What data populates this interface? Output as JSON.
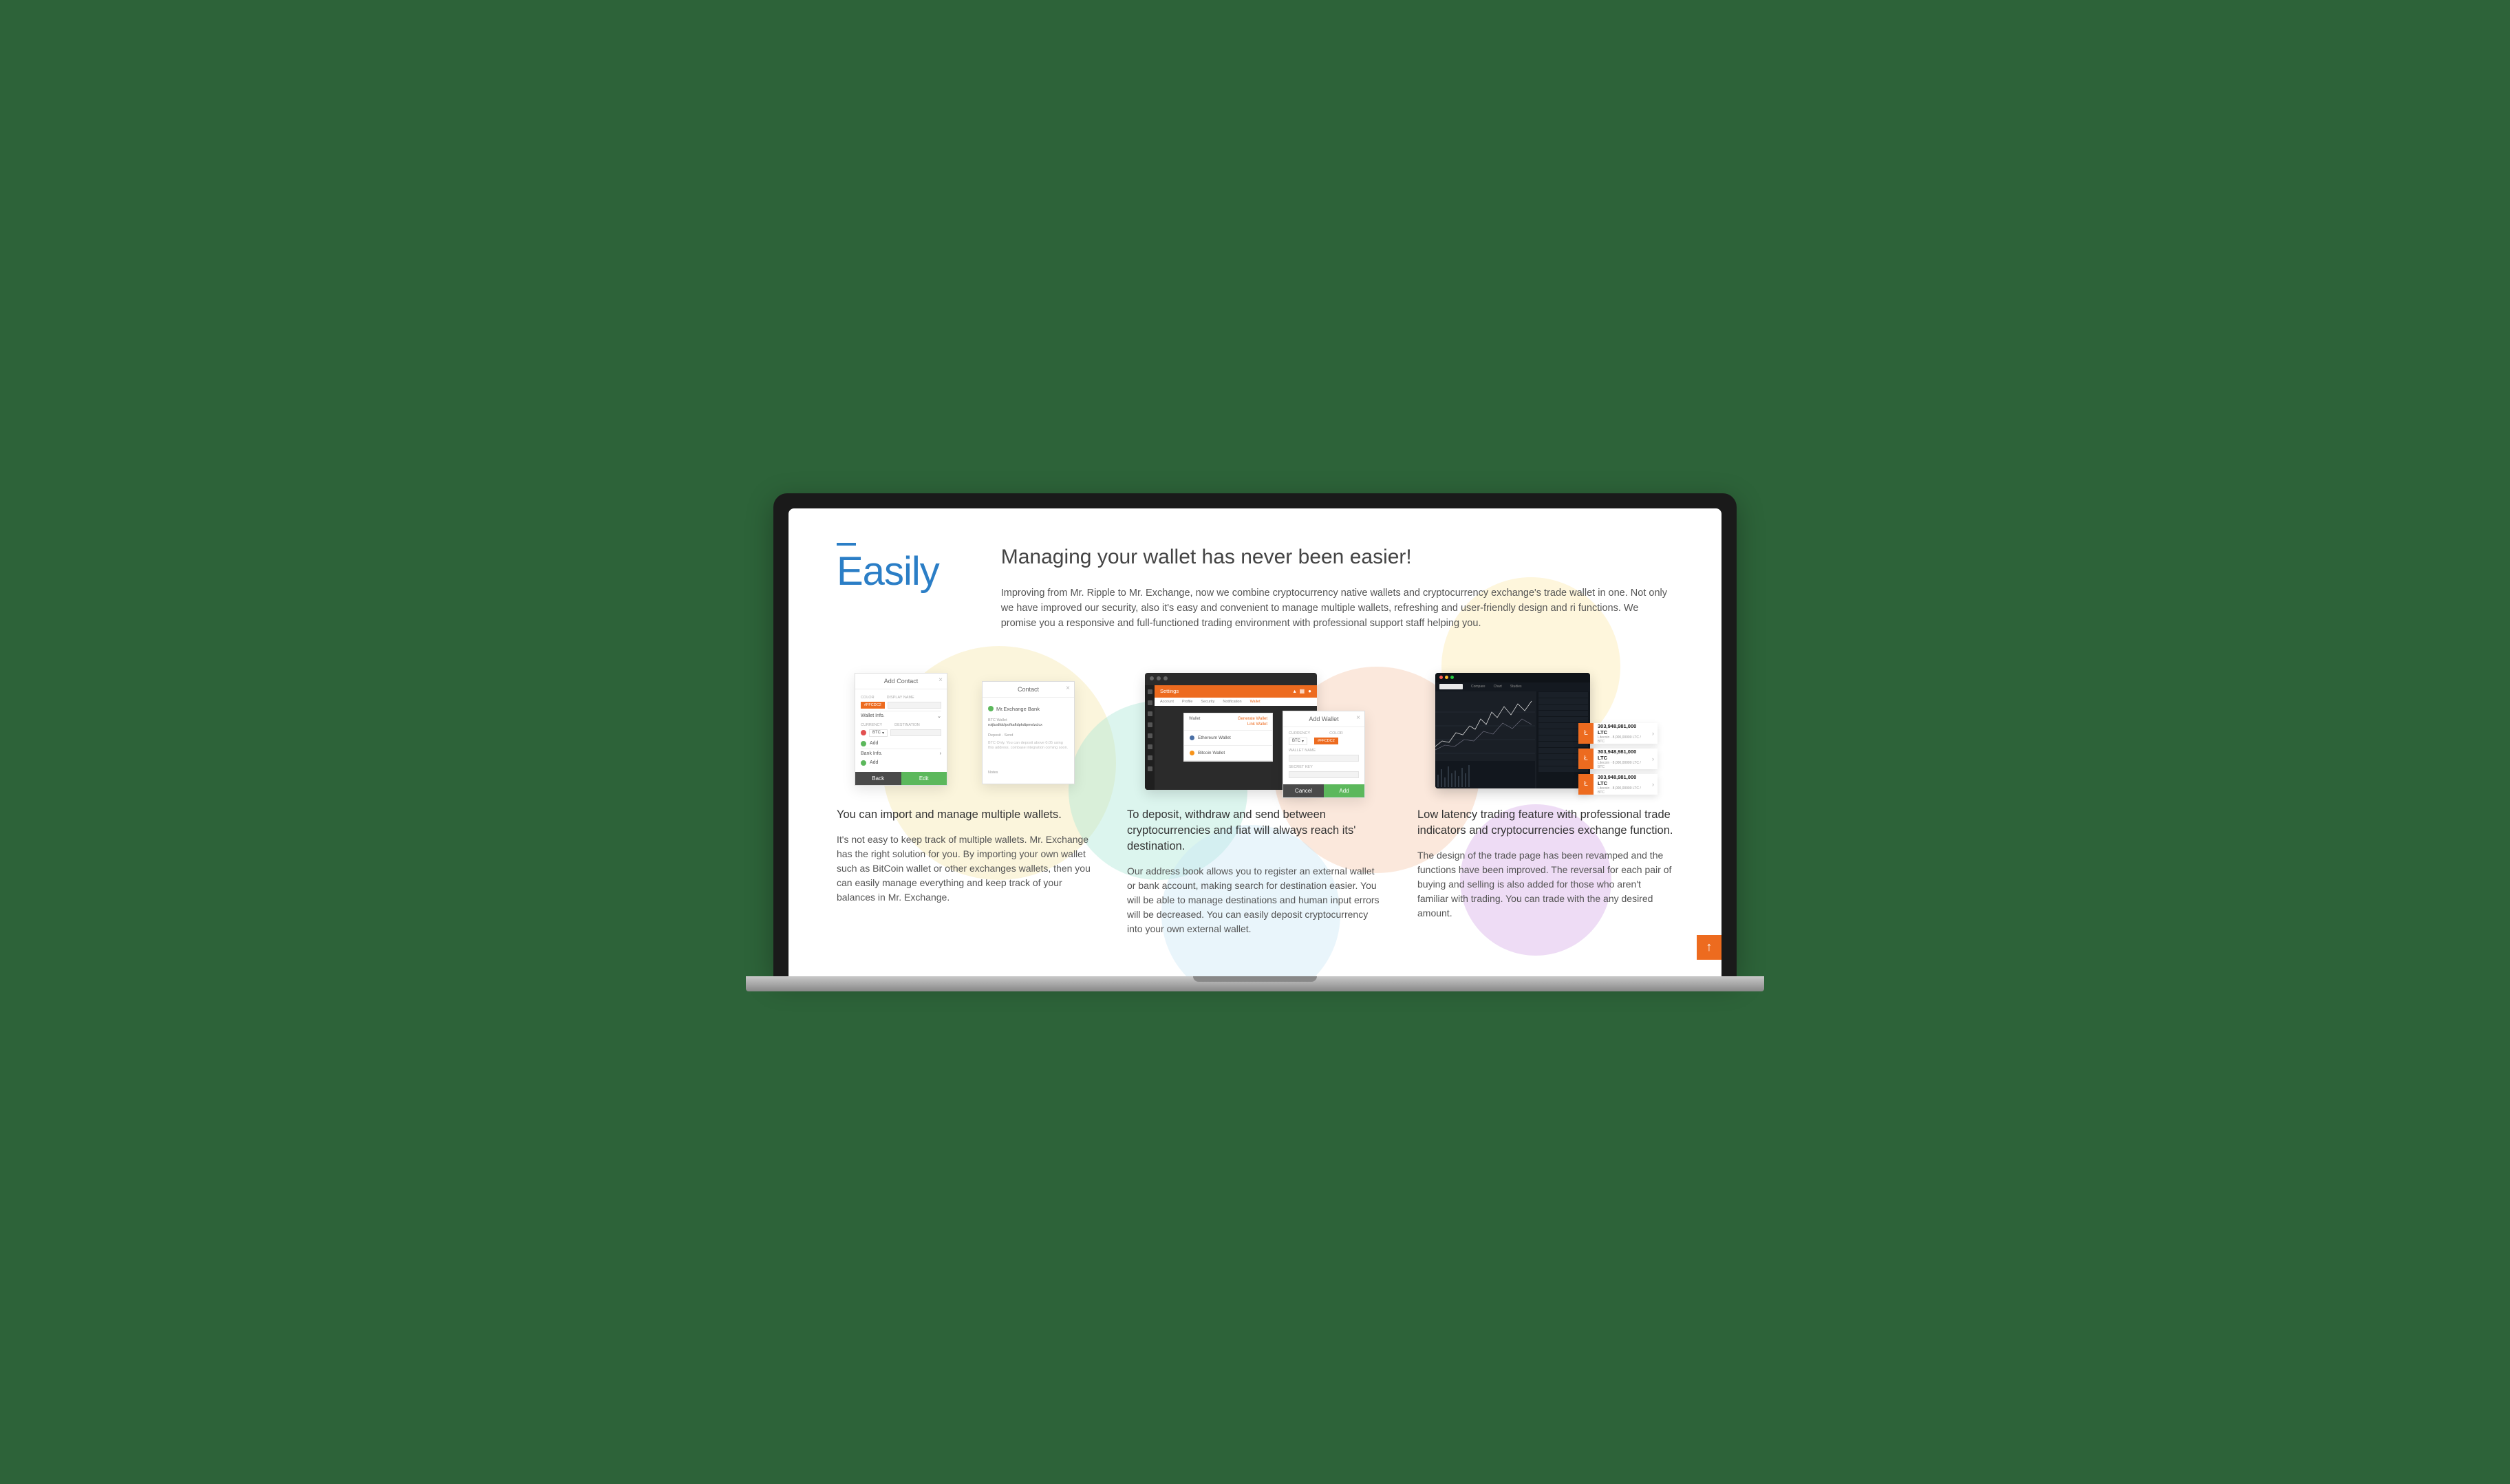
{
  "header": {
    "accent_label": "Easily",
    "headline": "Managing your wallet has never been easier!",
    "intro": "Improving from Mr. Ripple to Mr. Exchange, now we combine cryptocurrency native wallets and cryptocurrency exchange's trade wallet in one. Not only we have improved our security, also it's easy and convenient to manage multiple wallets, refreshing and user-friendly design and ri functions. We promise you a responsive and full-functioned trading environment with professional support staff helping you."
  },
  "features": [
    {
      "title": "You can import and manage multiple wallets.",
      "body": "It's not easy to keep track of multiple wallets. Mr. Exchange has the right solution for you. By importing your own wallet such as BitCoin wallet or other exchanges wallets, then you can easily manage everything and keep track of your balances in Mr. Exchange."
    },
    {
      "title": "To deposit, withdraw and send between cryptocurrencies and fiat will always reach its' destination.",
      "body": "Our address book allows you to register an external wallet or bank account, making search for destination easier. You will be able to manage destinations and human input errors will be decreased. You can easily deposit cryptocurrency into your own external wallet."
    },
    {
      "title": "Low latency trading feature with professional trade indicators and cryptocurrencies exchange function.",
      "body": "The design of the trade page has been revamped and the functions have been improved. The reversal for each pair of buying and selling is also added for those who aren't familiar with trading. You can trade with the any desired amount."
    }
  ],
  "mock1": {
    "add_contact_title": "Add Contact",
    "contact_title": "Contact",
    "color_label": "COLOR",
    "display_name_label": "DISPLAY NAME",
    "swatch_hex": "#FFCDC2",
    "wallet_info": "Wallet Info.",
    "currency": "CURRENCY",
    "destination": "DESTINATION",
    "btc": "BTC",
    "add": "Add",
    "bank_info": "Bank Info.",
    "back": "Back",
    "edit": "Edit",
    "contact_name": "Mr.Exchange Bank",
    "btc_wallet": "BTC Wallet",
    "addr": "roijbzdfdcfpofkaftdpkdtpmvlzclcx",
    "notes": "Notes"
  },
  "mock2": {
    "settings": "Settings",
    "subtabs": [
      "Account",
      "Profile",
      "Security",
      "Notification",
      "Wallet"
    ],
    "wallet_lbl": "Wallet",
    "generate": "Generate Wallet",
    "link": "Link Wallet",
    "eth": "Ethereum Wallet",
    "btc": "Bitcoin Wallet",
    "add_wallet": "Add Wallet",
    "currency": "CURRENCY",
    "color": "COLOR",
    "btc_sel": "BTC",
    "swatch_hex": "#FFCDC2",
    "wallet_name": "WALLET NAME",
    "secret_key": "SECRET KEY",
    "cancel": "Cancel",
    "add": "Add"
  },
  "mock3": {
    "chart_tabs": [
      "Compare",
      "Chart",
      "Studies"
    ],
    "ltc_value": "303,948,981,000 LTC",
    "ltc_sub": "Litecoin · 8,000,00000 LTC / BTC"
  },
  "colors": {
    "accent_blue": "#2b7ec6",
    "brand_orange": "#ed6b1f",
    "green": "#5cb85c"
  }
}
